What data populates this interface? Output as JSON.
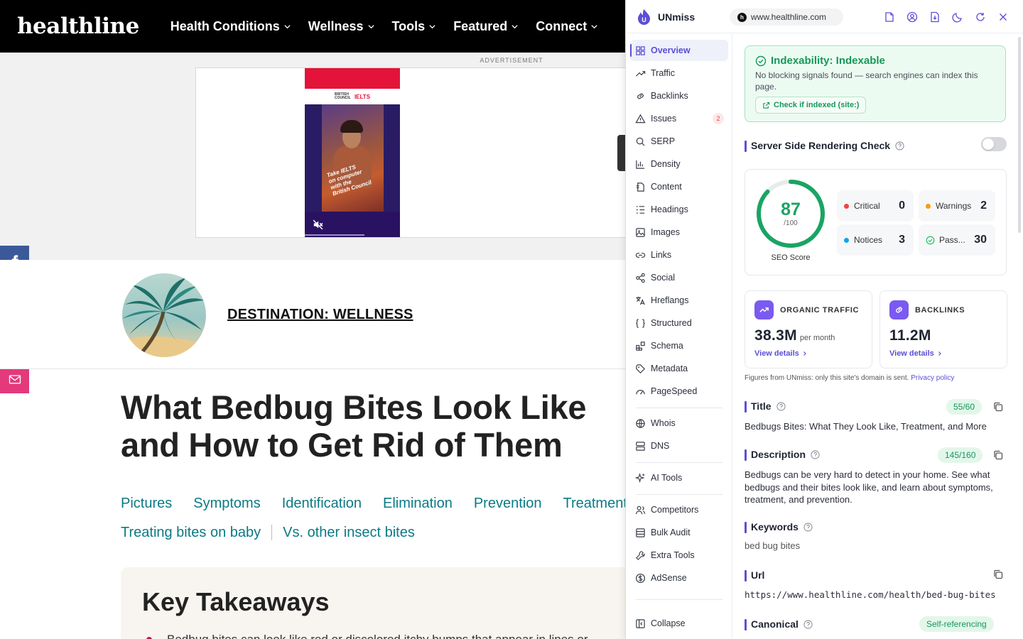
{
  "site": {
    "logo": "healthline",
    "nav": [
      "Health Conditions",
      "Wellness",
      "Tools",
      "Featured",
      "Connect"
    ],
    "ad_label": "ADVERTISEMENT",
    "ad": {
      "brand_small": "BRITISH COUNCIL",
      "brand": "IELTS",
      "tagline": [
        "Take IELTS",
        "on computer",
        "with the",
        "British Council"
      ]
    },
    "share": [
      "facebook-icon",
      "x-icon",
      "flipboard-icon",
      "pinterest-icon",
      "email-icon"
    ],
    "share_colors": {
      "facebook": "#3b5998",
      "x": "#000000",
      "flipboard": "#e12828",
      "pinterest": "#c8232c",
      "email": "#e4397b"
    },
    "destination_link": "DESTINATION: WELLNESS",
    "headline": "What Bedbug Bites Look Like and How to Get Rid of Them",
    "toc_row1": [
      "Pictures",
      "Symptoms",
      "Identification",
      "Elimination",
      "Prevention",
      "Treatment"
    ],
    "toc_row2": [
      "Treating bites on baby",
      "Vs. other insect bites"
    ],
    "takeaways_title": "Key Takeaways",
    "takeaways_first": "Bedbug bites can look like red or discolored itchy bumps that appear in lines or"
  },
  "ext": {
    "name": "UNmiss",
    "url": "www.healthline.com",
    "accent": "#5b4fd6",
    "sidebar": [
      {
        "label": "Overview",
        "icon": "grid-icon",
        "active": true
      },
      {
        "label": "Traffic",
        "icon": "trend-icon"
      },
      {
        "label": "Backlinks",
        "icon": "link-icon"
      },
      {
        "label": "Issues",
        "icon": "warning-icon",
        "badge": "2"
      },
      {
        "label": "SERP",
        "icon": "search-icon"
      },
      {
        "label": "Density",
        "icon": "bar-chart-icon"
      },
      {
        "label": "Content",
        "icon": "document-icon"
      },
      {
        "label": "Headings",
        "icon": "list-icon"
      },
      {
        "label": "Images",
        "icon": "image-icon"
      },
      {
        "label": "Links",
        "icon": "chain-icon"
      },
      {
        "label": "Social",
        "icon": "share-icon"
      },
      {
        "label": "Hreflangs",
        "icon": "translate-icon"
      },
      {
        "label": "Structured",
        "icon": "braces-icon"
      },
      {
        "label": "Schema",
        "icon": "blocks-icon"
      },
      {
        "label": "Metadata",
        "icon": "tag-icon"
      },
      {
        "label": "PageSpeed",
        "icon": "gauge-icon"
      },
      {
        "label": "Whois",
        "icon": "globe-icon"
      },
      {
        "label": "DNS",
        "icon": "server-icon"
      },
      {
        "label": "AI Tools",
        "icon": "sparkle-icon"
      },
      {
        "label": "Competitors",
        "icon": "users-icon"
      },
      {
        "label": "Bulk Audit",
        "icon": "stack-icon"
      },
      {
        "label": "Extra Tools",
        "icon": "wrench-icon"
      },
      {
        "label": "AdSense",
        "icon": "dollar-icon"
      }
    ],
    "collapse": "Collapse",
    "indexability": {
      "title": "Indexability: Indexable",
      "desc": "No blocking signals found — search engines can index this page.",
      "button": "Check if indexed (site:)"
    },
    "ssr_title": "Server Side Rendering Check",
    "ssr_enabled": false,
    "seo": {
      "score": "87",
      "max": "/100",
      "score_value": 87,
      "label": "SEO Score",
      "stats": [
        {
          "label": "Critical",
          "value": "0",
          "color": "#ef4444"
        },
        {
          "label": "Warnings",
          "value": "2",
          "color": "#f59e0b"
        },
        {
          "label": "Notices",
          "value": "3",
          "color": "#0ea5e9"
        },
        {
          "label": "Pass...",
          "value": "30",
          "color": "#22c55e"
        }
      ]
    },
    "organic": {
      "label": "ORGANIC TRAFFIC",
      "value": "38.3M",
      "unit": "per month",
      "link": "View details"
    },
    "backlinks": {
      "label": "BACKLINKS",
      "value": "11.2M",
      "link": "View details"
    },
    "figures_note": "Figures from UNmiss: only this site's domain is sent.",
    "privacy_link": "Privacy policy",
    "title_field": {
      "label": "Title",
      "count": "55/60",
      "value": "Bedbugs Bites: What They Look Like, Treatment, and More"
    },
    "desc_field": {
      "label": "Description",
      "count": "145/160",
      "value": "Bedbugs can be very hard to detect in your home. See what bedbugs and their bites look like, and learn about symptoms, treatment, and prevention."
    },
    "keywords_field": {
      "label": "Keywords",
      "value": "bed bug bites"
    },
    "url_field": {
      "label": "Url",
      "value": "https://www.healthline.com/health/bed-bug-bites"
    },
    "canonical_field": {
      "label": "Canonical",
      "status": "Self-referencing"
    }
  }
}
